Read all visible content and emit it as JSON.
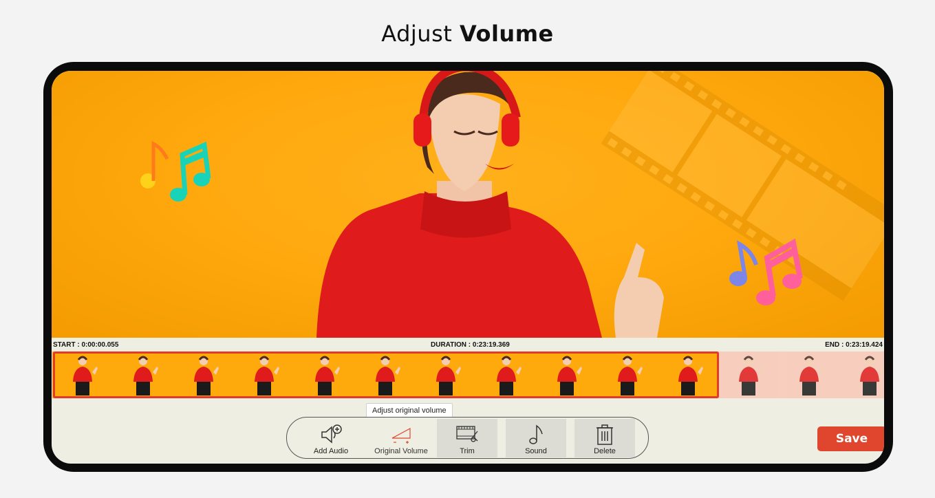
{
  "heading": {
    "prefix": "Adjust",
    "bold": "Volume"
  },
  "timeline": {
    "start": "START : 0:00:00.055",
    "duration": "DURATION : 0:23:19.369",
    "end": "END : 0:23:19.424"
  },
  "tooltip": "Adjust original volume",
  "toolbar": {
    "add_audio": "Add Audio",
    "original_volume": "Original Volume",
    "trim": "Trim",
    "sound": "Sound",
    "delete": "Delete"
  },
  "save_label": "Save",
  "colors": {
    "accent": "#e0462e",
    "selection": "#e33b25",
    "preview_bg": "#ffa90f",
    "panel_bg": "#efeee3"
  },
  "icons": {
    "add_audio": "speaker-plus-icon",
    "original_volume": "volume-ramp-icon",
    "trim": "film-scissors-icon",
    "sound": "music-note-icon",
    "delete": "trash-icon"
  }
}
